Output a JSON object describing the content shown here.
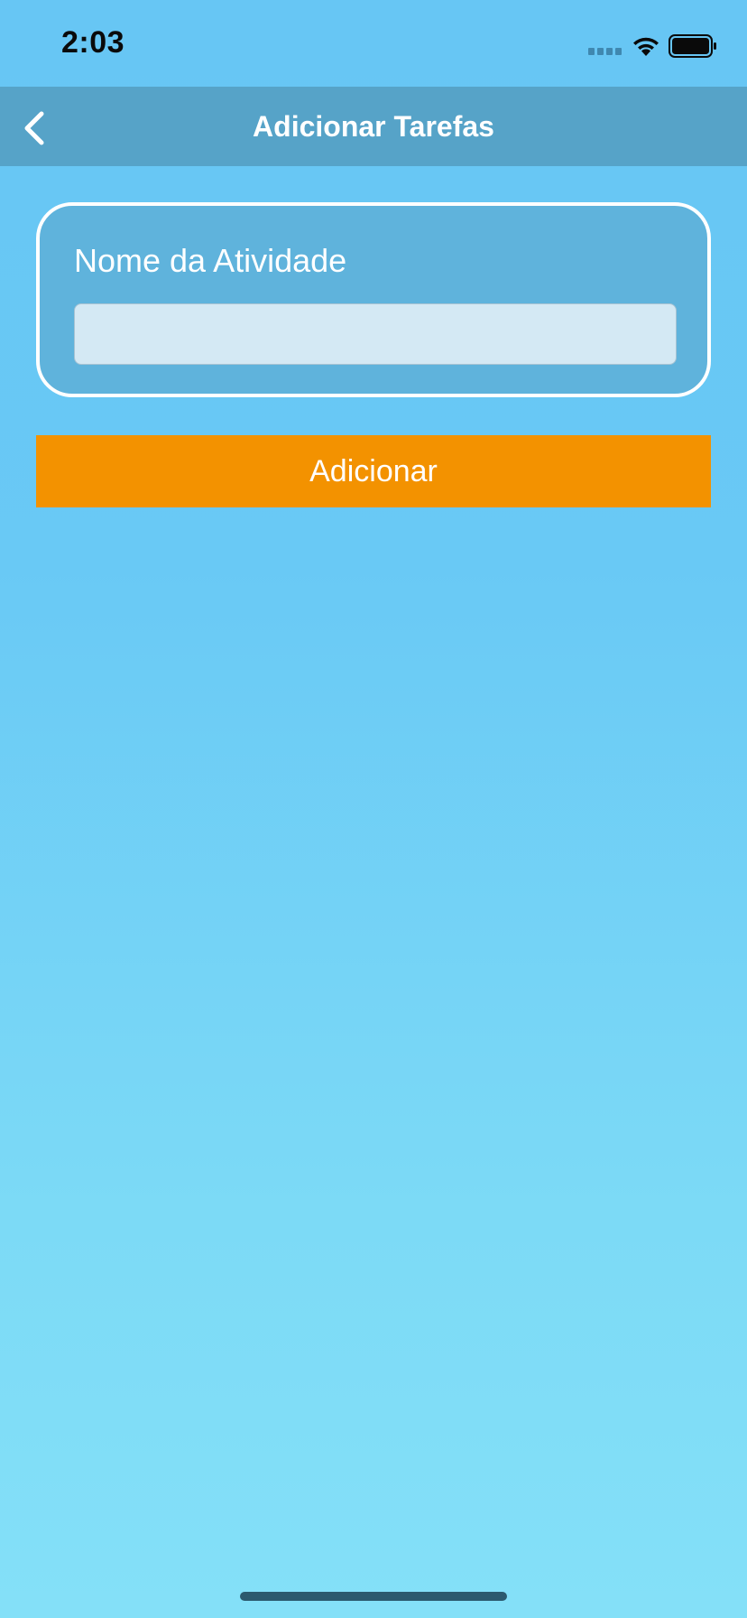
{
  "status_bar": {
    "time": "2:03"
  },
  "nav_bar": {
    "title": "Adicionar Tarefas",
    "back_icon": "chevron-left-icon"
  },
  "form": {
    "label": "Nome da Atividade",
    "input_value": "",
    "input_placeholder": ""
  },
  "actions": {
    "add_label": "Adicionar"
  },
  "colors": {
    "background_top": "#67c6f4",
    "background_bottom": "#84e0f8",
    "nav_bar": "#56a3c8",
    "card": "#5fb3dc",
    "card_border": "#ffffff",
    "input": "#d4e9f4",
    "button": "#f39200"
  }
}
